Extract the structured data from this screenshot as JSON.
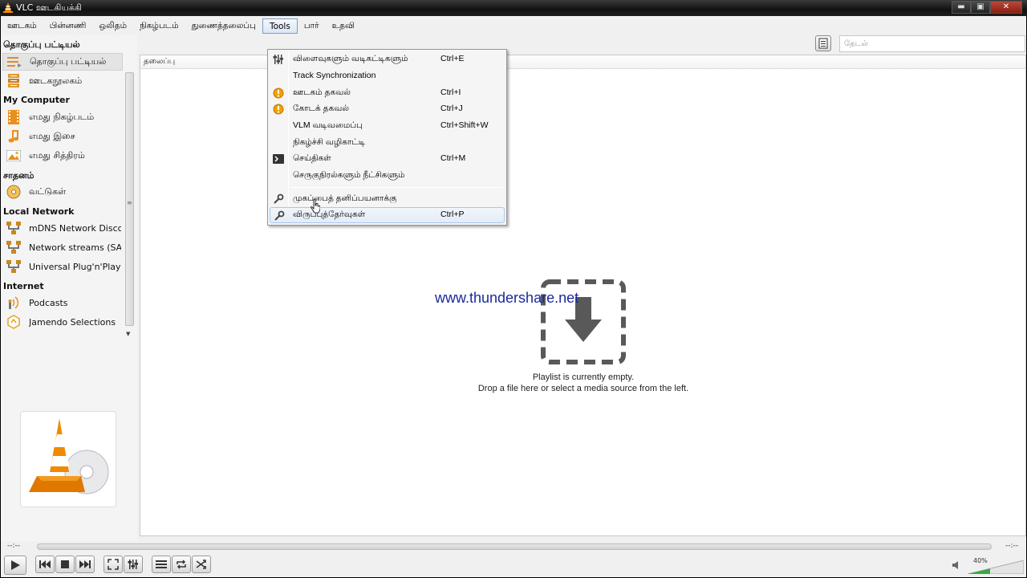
{
  "window": {
    "title": "VLC ஊடகியக்கி",
    "minimize": "▬",
    "maximize": "▣",
    "close": "✕"
  },
  "menubar": {
    "items": [
      "ஊடகம்",
      "பின்னணி",
      "ஒலிதம்",
      "நிகழ்படம்",
      "துணைத்தலைப்பு",
      "Tools",
      "பார்",
      "உதவி"
    ],
    "active": "Tools"
  },
  "tools_menu": {
    "items": [
      {
        "label": "விளைவுகளும் வடிகட்டிகளும்",
        "shortcut": "Ctrl+E",
        "icon": "equalizer-icon"
      },
      {
        "label": "Track Synchronization",
        "shortcut": "",
        "icon": ""
      },
      {
        "label": "ஊடகம் தகவல்",
        "shortcut": "Ctrl+I",
        "icon": "info-icon"
      },
      {
        "label": "கோடக் தகவல்",
        "shortcut": "Ctrl+J",
        "icon": "info-icon"
      },
      {
        "label": "VLM வடிவமைப்பு",
        "shortcut": "Ctrl+Shift+W",
        "icon": ""
      },
      {
        "label": "நிகழ்ச்சி வழிகாட்டி",
        "shortcut": "",
        "icon": ""
      },
      {
        "label": "செய்திகள்",
        "shortcut": "Ctrl+M",
        "icon": "messages-icon"
      },
      {
        "label": "செருகுநிரல்களும் நீட்சிகளும்",
        "shortcut": "",
        "icon": ""
      },
      {
        "label": "முகப்பைத் தனிப்பயனாக்கு",
        "shortcut": "",
        "icon": "wrench-icon"
      },
      {
        "label": "விருப்புத்தேர்வுகள்",
        "shortcut": "Ctrl+P",
        "icon": "wrench-icon"
      }
    ]
  },
  "sidebar": {
    "headers": {
      "playlist": "தொகுப்பு பட்டியல்",
      "my_computer": "My Computer",
      "devices": "சாதனம்",
      "local_network": "Local Network",
      "internet": "Internet"
    },
    "items": {
      "playlist": "தொகுப்பு பட்டியல்",
      "media_library": "ஊடகநூலகம்",
      "my_videos": "எமது நிகழ்படம்",
      "my_music": "எமது இசை",
      "my_pictures": "எமது சித்திரம்",
      "discs": "வட்டுகள்",
      "mdns": "mDNS Network Disco...",
      "sap": "Network streams (SAP)",
      "upnp": "Universal Plug'n'Play",
      "podcasts": "Podcasts",
      "jamendo": "Jamendo Selections"
    }
  },
  "search": {
    "placeholder": "தேடல்"
  },
  "playlist": {
    "column_title": "தலைப்பு",
    "empty_line1": "Playlist is currently empty.",
    "empty_line2": "Drop a file here or select a media source from the left."
  },
  "watermark": "www.thundershare.net",
  "controls": {
    "time_elapsed": "--:--",
    "time_total": "--:--",
    "volume": "40%",
    "volume_level": 0.4
  }
}
